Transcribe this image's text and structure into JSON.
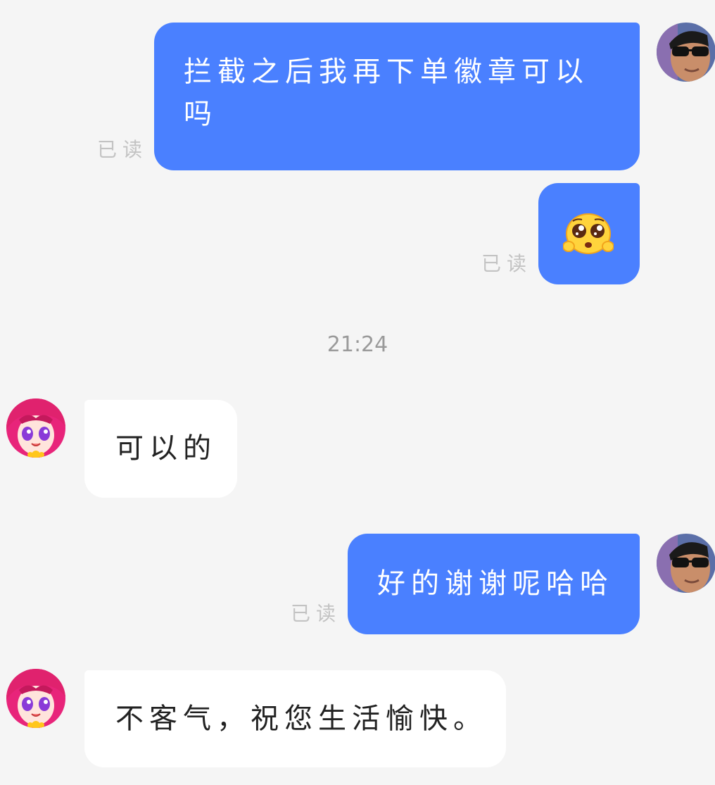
{
  "conversation": {
    "timestamp": "21:24",
    "read_label": "已读",
    "messages": [
      {
        "sender": "self",
        "type": "text",
        "text": "拦截之后我再下单徽章可以吗"
      },
      {
        "sender": "self",
        "type": "emoji",
        "emoji_icon": "pleading-face-icon"
      },
      {
        "sender": "other",
        "type": "text",
        "text": "可以的"
      },
      {
        "sender": "self",
        "type": "text",
        "text": "好的谢谢呢哈哈"
      },
      {
        "sender": "other",
        "type": "text",
        "text": "不客气，祝您生活愉快。"
      }
    ]
  },
  "colors": {
    "outgoing_bubble": "#4a80ff",
    "incoming_bubble": "#ffffff",
    "background": "#f5f5f5",
    "read_label": "#c3c3c3"
  }
}
